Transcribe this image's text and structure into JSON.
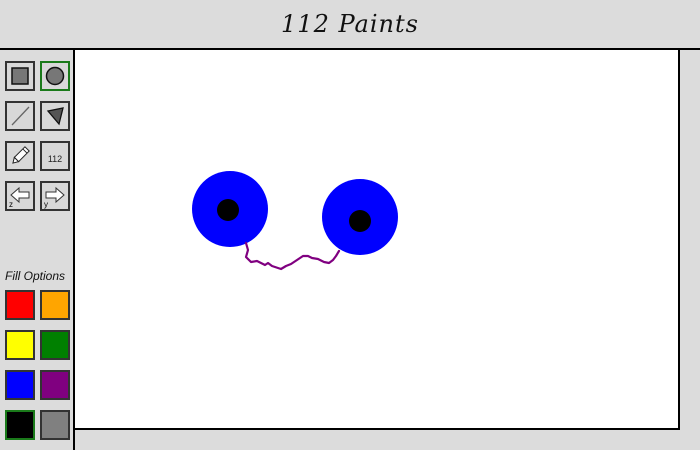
{
  "app": {
    "title": "112 Paints"
  },
  "tools": [
    {
      "name": "rectangle-tool",
      "icon": "square-icon",
      "active": false
    },
    {
      "name": "circle-tool",
      "icon": "circle-icon",
      "active": true
    },
    {
      "name": "line-tool",
      "icon": "line-icon",
      "active": false
    },
    {
      "name": "polygon-tool",
      "icon": "triangle-icon",
      "active": false
    },
    {
      "name": "pencil-tool",
      "icon": "pencil-icon",
      "active": false
    },
    {
      "name": "text-tool",
      "icon": "text-icon",
      "label": "112",
      "active": false
    },
    {
      "name": "undo-button",
      "icon": "arrow-left-icon",
      "hint": "z"
    },
    {
      "name": "redo-button",
      "icon": "arrow-right-icon",
      "hint": "y"
    }
  ],
  "fill_options": {
    "label": "Fill Options",
    "selected": "black",
    "colors": [
      {
        "name": "red",
        "hex": "#ff0000"
      },
      {
        "name": "orange",
        "hex": "#ffa500"
      },
      {
        "name": "yellow",
        "hex": "#ffff00"
      },
      {
        "name": "green",
        "hex": "#008000"
      },
      {
        "name": "blue",
        "hex": "#0000ff"
      },
      {
        "name": "purple",
        "hex": "#800080"
      },
      {
        "name": "black",
        "hex": "#000000"
      },
      {
        "name": "gray",
        "hex": "#808080"
      }
    ]
  },
  "drawing": {
    "shapes": [
      {
        "type": "circle",
        "fill": "#0000ff"
      },
      {
        "type": "circle",
        "fill": "#000000"
      },
      {
        "type": "circle",
        "fill": "#0000ff"
      },
      {
        "type": "circle",
        "fill": "#000000"
      },
      {
        "type": "freehand",
        "stroke": "#800080"
      }
    ]
  }
}
